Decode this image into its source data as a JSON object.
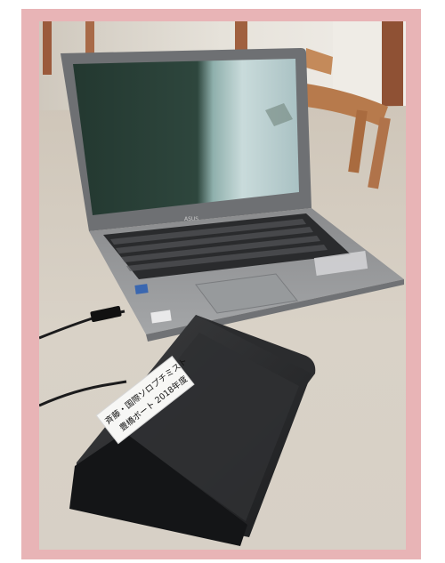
{
  "photo": {
    "frame_color": "#e8b4b6",
    "label": {
      "line1": "斉藤・国際ソロプチミスト",
      "line2": "豊橋ボート 2018年度"
    },
    "laptop_brand": "ASUS"
  }
}
